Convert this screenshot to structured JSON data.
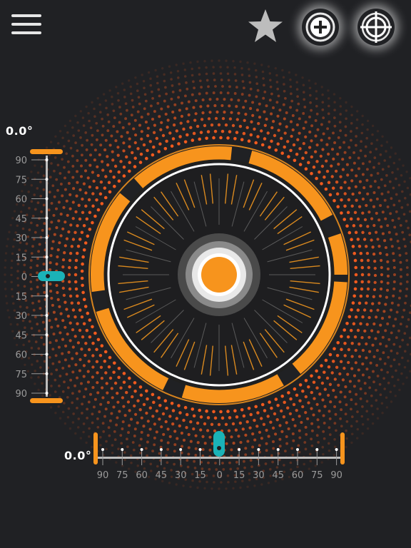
{
  "toolbar": {
    "menu_icon": "hamburger-menu-icon",
    "star_icon": "star-icon",
    "zoom_icon": "plus-circle-icon",
    "calibrate_icon": "crosshair-icon"
  },
  "vertical_scale": {
    "readout": "0.0°",
    "labels": [
      "90",
      "75",
      "60",
      "45",
      "30",
      "15",
      "0",
      "15",
      "30",
      "45",
      "60",
      "75",
      "90"
    ],
    "value": 0
  },
  "horizontal_scale": {
    "readout": "0.0°",
    "labels": [
      "90",
      "75",
      "60",
      "45",
      "30",
      "15",
      "0",
      "15",
      "30",
      "45",
      "60",
      "75",
      "90"
    ],
    "value": 0
  },
  "colors": {
    "background": "#202124",
    "accent": "#f7941d",
    "indicator": "#1bb3b8",
    "dots": "#f05a1e"
  }
}
